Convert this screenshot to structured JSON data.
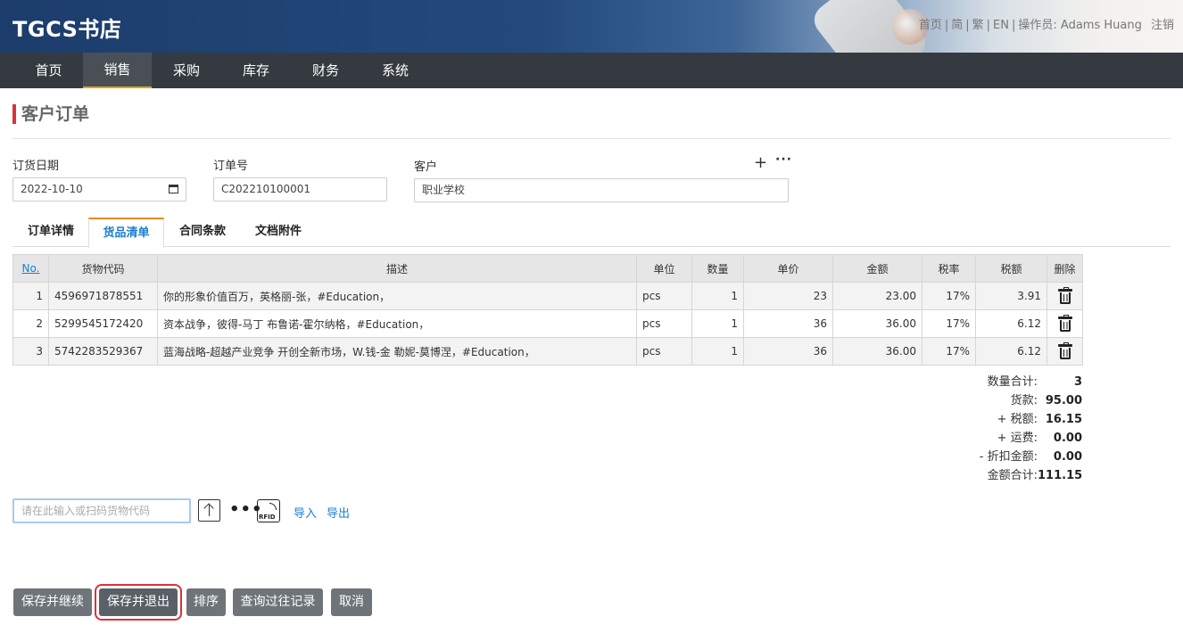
{
  "app": {
    "logo": "TGCS书店",
    "toplinks": [
      "首页",
      "简",
      "繁",
      "EN"
    ],
    "operator_label": "操作员:",
    "operator_name": "Adams Huang",
    "logout": "注销"
  },
  "nav": {
    "items": [
      "首页",
      "销售",
      "采购",
      "库存",
      "财务",
      "系统"
    ],
    "active": "销售"
  },
  "page": {
    "title": "客户订单"
  },
  "form": {
    "order_date_label": "订货日期",
    "order_date_value": "2022-10-10",
    "order_no_label": "订单号",
    "order_no_value": "C202210100001",
    "customer_label": "客户",
    "customer_value": "职业学校"
  },
  "tabs": [
    "订单详情",
    "货品清单",
    "合同条款",
    "文档附件"
  ],
  "active_tab": "货品清单",
  "table": {
    "headers": [
      "No.",
      "货物代码",
      "描述",
      "单位",
      "数量",
      "单价",
      "金额",
      "税率",
      "税额",
      "删除"
    ],
    "rows": [
      [
        "1",
        "4596971878551",
        "你的形象价值百万，英格丽-张，#Education，",
        "pcs",
        "1",
        "23",
        "23.00",
        "17%",
        "3.91"
      ],
      [
        "2",
        "5299545172420",
        "资本战争，彼得-马丁 布鲁诺-霍尔纳格，#Education，",
        "pcs",
        "1",
        "36",
        "36.00",
        "17%",
        "6.12"
      ],
      [
        "3",
        "5742283529367",
        "蓝海战略-超越产业竞争 开创全新市场，W.钱-金 勒妮-莫博涅，#Education，",
        "pcs",
        "1",
        "36",
        "36.00",
        "17%",
        "6.12"
      ]
    ]
  },
  "totals": [
    {
      "label": "数量合计:",
      "value": "3"
    },
    {
      "label": "货款:",
      "value": "95.00"
    },
    {
      "label": "+ 税额:",
      "value": "16.15"
    },
    {
      "label": "+ 运费:",
      "value": "0.00"
    },
    {
      "label": "- 折扣金额:",
      "value": "0.00"
    },
    {
      "label": "金额合计:",
      "value": "111.15"
    }
  ],
  "entry": {
    "placeholder": "请在此输入或扫码货物代码",
    "rfid_text": "RFID",
    "import": "导入",
    "export": "导出"
  },
  "buttons": [
    "保存并继续",
    "保存并退出",
    "排序",
    "查询过往记录",
    "取消"
  ]
}
